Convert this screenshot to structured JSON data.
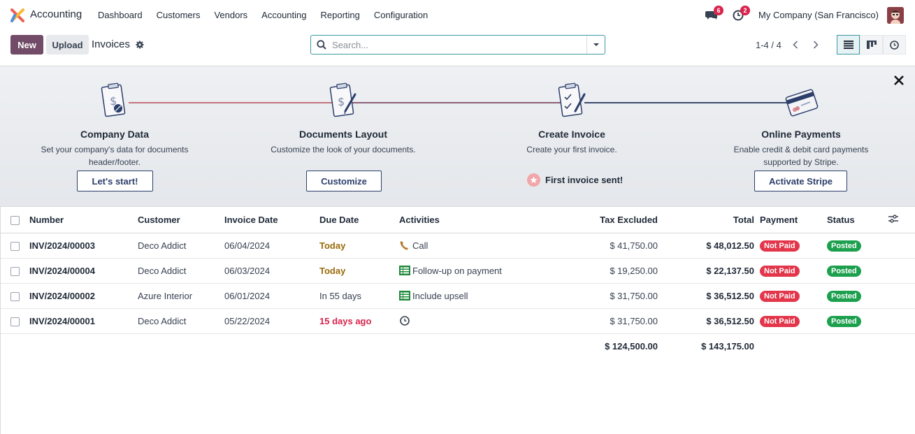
{
  "navbar": {
    "app_name": "Accounting",
    "menu": [
      "Dashboard",
      "Customers",
      "Vendors",
      "Accounting",
      "Reporting",
      "Configuration"
    ],
    "messages_count": "6",
    "activities_count": "2",
    "company": "My Company (San Francisco)"
  },
  "control_panel": {
    "new_label": "New",
    "upload_label": "Upload",
    "breadcrumb": "Invoices",
    "search_placeholder": "Search...",
    "pager": "1-4 / 4"
  },
  "onboarding": {
    "steps": [
      {
        "title": "Company Data",
        "desc": "Set your company's data for documents header/footer.",
        "button": "Let's start!"
      },
      {
        "title": "Documents Layout",
        "desc": "Customize the look of your documents.",
        "button": "Customize"
      },
      {
        "title": "Create Invoice",
        "desc": "Create your first invoice.",
        "done": "First invoice sent!"
      },
      {
        "title": "Online Payments",
        "desc": "Enable credit & debit card payments supported by Stripe.",
        "button": "Activate Stripe"
      }
    ]
  },
  "table": {
    "columns": {
      "number": "Number",
      "customer": "Customer",
      "invoice_date": "Invoice Date",
      "due_date": "Due Date",
      "activities": "Activities",
      "tax_excluded": "Tax Excluded",
      "total": "Total",
      "payment": "Payment",
      "status": "Status"
    },
    "rows": [
      {
        "number": "INV/2024/00003",
        "customer": "Deco Addict",
        "invoice_date": "06/04/2024",
        "due_date": "Today",
        "activity": "Call",
        "tax_excluded": "$ 41,750.00",
        "total": "$ 48,012.50",
        "payment": "Not Paid",
        "status": "Posted"
      },
      {
        "number": "INV/2024/00004",
        "customer": "Deco Addict",
        "invoice_date": "06/03/2024",
        "due_date": "Today",
        "activity": "Follow-up on payment",
        "tax_excluded": "$ 19,250.00",
        "total": "$ 22,137.50",
        "payment": "Not Paid",
        "status": "Posted"
      },
      {
        "number": "INV/2024/00002",
        "customer": "Azure Interior",
        "invoice_date": "06/01/2024",
        "due_date": "In 55 days",
        "activity": "Include upsell",
        "tax_excluded": "$ 31,750.00",
        "total": "$ 36,512.50",
        "payment": "Not Paid",
        "status": "Posted"
      },
      {
        "number": "INV/2024/00001",
        "customer": "Deco Addict",
        "invoice_date": "05/22/2024",
        "due_date": "15 days ago",
        "activity": "",
        "tax_excluded": "$ 31,750.00",
        "total": "$ 36,512.50",
        "payment": "Not Paid",
        "status": "Posted"
      }
    ],
    "totals": {
      "tax_excluded": "$ 124,500.00",
      "total": "$ 143,175.00"
    }
  },
  "colors": {
    "brand": "#714b67",
    "accent": "#3c9aa3",
    "danger": "#e3364b",
    "success": "#1ca04e"
  }
}
